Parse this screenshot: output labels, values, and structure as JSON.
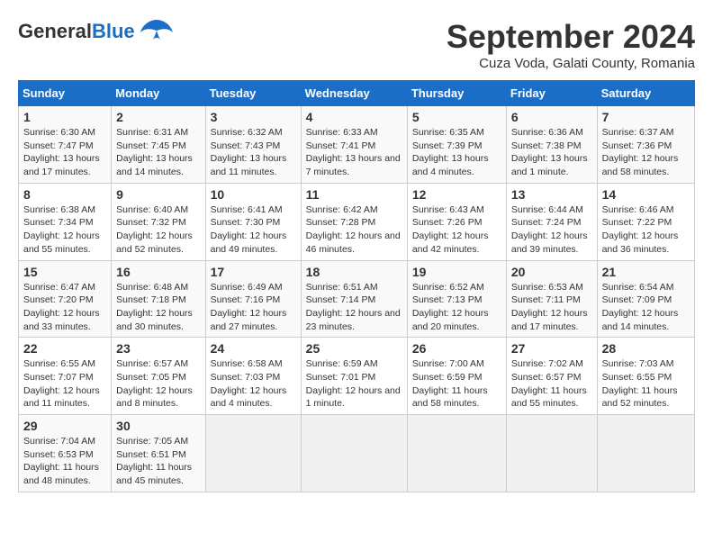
{
  "header": {
    "logo_general": "General",
    "logo_blue": "Blue",
    "month_title": "September 2024",
    "location": "Cuza Voda, Galati County, Romania"
  },
  "weekdays": [
    "Sunday",
    "Monday",
    "Tuesday",
    "Wednesday",
    "Thursday",
    "Friday",
    "Saturday"
  ],
  "weeks": [
    [
      {
        "day": "1",
        "info": "Sunrise: 6:30 AM\nSunset: 7:47 PM\nDaylight: 13 hours and 17 minutes."
      },
      {
        "day": "2",
        "info": "Sunrise: 6:31 AM\nSunset: 7:45 PM\nDaylight: 13 hours and 14 minutes."
      },
      {
        "day": "3",
        "info": "Sunrise: 6:32 AM\nSunset: 7:43 PM\nDaylight: 13 hours and 11 minutes."
      },
      {
        "day": "4",
        "info": "Sunrise: 6:33 AM\nSunset: 7:41 PM\nDaylight: 13 hours and 7 minutes."
      },
      {
        "day": "5",
        "info": "Sunrise: 6:35 AM\nSunset: 7:39 PM\nDaylight: 13 hours and 4 minutes."
      },
      {
        "day": "6",
        "info": "Sunrise: 6:36 AM\nSunset: 7:38 PM\nDaylight: 13 hours and 1 minute."
      },
      {
        "day": "7",
        "info": "Sunrise: 6:37 AM\nSunset: 7:36 PM\nDaylight: 12 hours and 58 minutes."
      }
    ],
    [
      {
        "day": "8",
        "info": "Sunrise: 6:38 AM\nSunset: 7:34 PM\nDaylight: 12 hours and 55 minutes."
      },
      {
        "day": "9",
        "info": "Sunrise: 6:40 AM\nSunset: 7:32 PM\nDaylight: 12 hours and 52 minutes."
      },
      {
        "day": "10",
        "info": "Sunrise: 6:41 AM\nSunset: 7:30 PM\nDaylight: 12 hours and 49 minutes."
      },
      {
        "day": "11",
        "info": "Sunrise: 6:42 AM\nSunset: 7:28 PM\nDaylight: 12 hours and 46 minutes."
      },
      {
        "day": "12",
        "info": "Sunrise: 6:43 AM\nSunset: 7:26 PM\nDaylight: 12 hours and 42 minutes."
      },
      {
        "day": "13",
        "info": "Sunrise: 6:44 AM\nSunset: 7:24 PM\nDaylight: 12 hours and 39 minutes."
      },
      {
        "day": "14",
        "info": "Sunrise: 6:46 AM\nSunset: 7:22 PM\nDaylight: 12 hours and 36 minutes."
      }
    ],
    [
      {
        "day": "15",
        "info": "Sunrise: 6:47 AM\nSunset: 7:20 PM\nDaylight: 12 hours and 33 minutes."
      },
      {
        "day": "16",
        "info": "Sunrise: 6:48 AM\nSunset: 7:18 PM\nDaylight: 12 hours and 30 minutes."
      },
      {
        "day": "17",
        "info": "Sunrise: 6:49 AM\nSunset: 7:16 PM\nDaylight: 12 hours and 27 minutes."
      },
      {
        "day": "18",
        "info": "Sunrise: 6:51 AM\nSunset: 7:14 PM\nDaylight: 12 hours and 23 minutes."
      },
      {
        "day": "19",
        "info": "Sunrise: 6:52 AM\nSunset: 7:13 PM\nDaylight: 12 hours and 20 minutes."
      },
      {
        "day": "20",
        "info": "Sunrise: 6:53 AM\nSunset: 7:11 PM\nDaylight: 12 hours and 17 minutes."
      },
      {
        "day": "21",
        "info": "Sunrise: 6:54 AM\nSunset: 7:09 PM\nDaylight: 12 hours and 14 minutes."
      }
    ],
    [
      {
        "day": "22",
        "info": "Sunrise: 6:55 AM\nSunset: 7:07 PM\nDaylight: 12 hours and 11 minutes."
      },
      {
        "day": "23",
        "info": "Sunrise: 6:57 AM\nSunset: 7:05 PM\nDaylight: 12 hours and 8 minutes."
      },
      {
        "day": "24",
        "info": "Sunrise: 6:58 AM\nSunset: 7:03 PM\nDaylight: 12 hours and 4 minutes."
      },
      {
        "day": "25",
        "info": "Sunrise: 6:59 AM\nSunset: 7:01 PM\nDaylight: 12 hours and 1 minute."
      },
      {
        "day": "26",
        "info": "Sunrise: 7:00 AM\nSunset: 6:59 PM\nDaylight: 11 hours and 58 minutes."
      },
      {
        "day": "27",
        "info": "Sunrise: 7:02 AM\nSunset: 6:57 PM\nDaylight: 11 hours and 55 minutes."
      },
      {
        "day": "28",
        "info": "Sunrise: 7:03 AM\nSunset: 6:55 PM\nDaylight: 11 hours and 52 minutes."
      }
    ],
    [
      {
        "day": "29",
        "info": "Sunrise: 7:04 AM\nSunset: 6:53 PM\nDaylight: 11 hours and 48 minutes."
      },
      {
        "day": "30",
        "info": "Sunrise: 7:05 AM\nSunset: 6:51 PM\nDaylight: 11 hours and 45 minutes."
      },
      {
        "day": "",
        "info": ""
      },
      {
        "day": "",
        "info": ""
      },
      {
        "day": "",
        "info": ""
      },
      {
        "day": "",
        "info": ""
      },
      {
        "day": "",
        "info": ""
      }
    ]
  ]
}
